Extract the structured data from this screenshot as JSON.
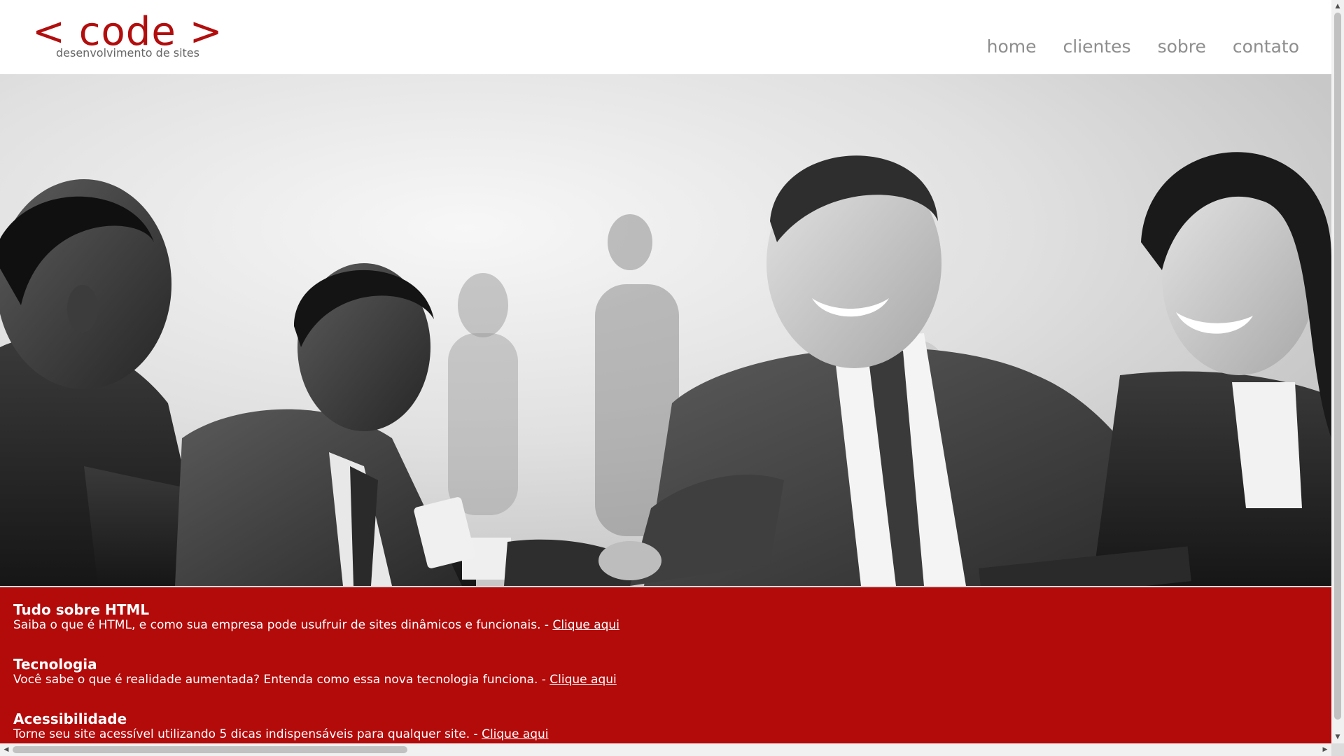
{
  "header": {
    "logo_main": "< code >",
    "logo_sub": "desenvolvimento de sites"
  },
  "nav": {
    "items": [
      {
        "label": "home"
      },
      {
        "label": "clientes"
      },
      {
        "label": "sobre"
      },
      {
        "label": "contato"
      }
    ]
  },
  "hero": {
    "image": "business-people-handshake-photo"
  },
  "articles": [
    {
      "title": "Tudo sobre HTML",
      "text": "Saiba o que é HTML, e como sua empresa pode usufruir de sites dinâmicos e funcionais. - ",
      "link": "Clique aqui"
    },
    {
      "title": "Tecnologia",
      "text": "Você sabe o que é realidade aumentada? Entenda como essa nova tecnologia funciona. - ",
      "link": "Clique aqui"
    },
    {
      "title": "Acessibilidade",
      "text": "Torne seu site acessível utilizando 5 dicas indispensáveis para qualquer site. - ",
      "link": "Clique aqui"
    }
  ],
  "colors": {
    "brand_red": "#b30a0a",
    "nav_gray": "#8e8e8e",
    "logo_sub_gray": "#666666"
  },
  "scrollbar_icons": {
    "up": "arrow-up-icon",
    "down": "arrow-down-icon",
    "left": "arrow-left-icon",
    "right": "arrow-right-icon"
  }
}
